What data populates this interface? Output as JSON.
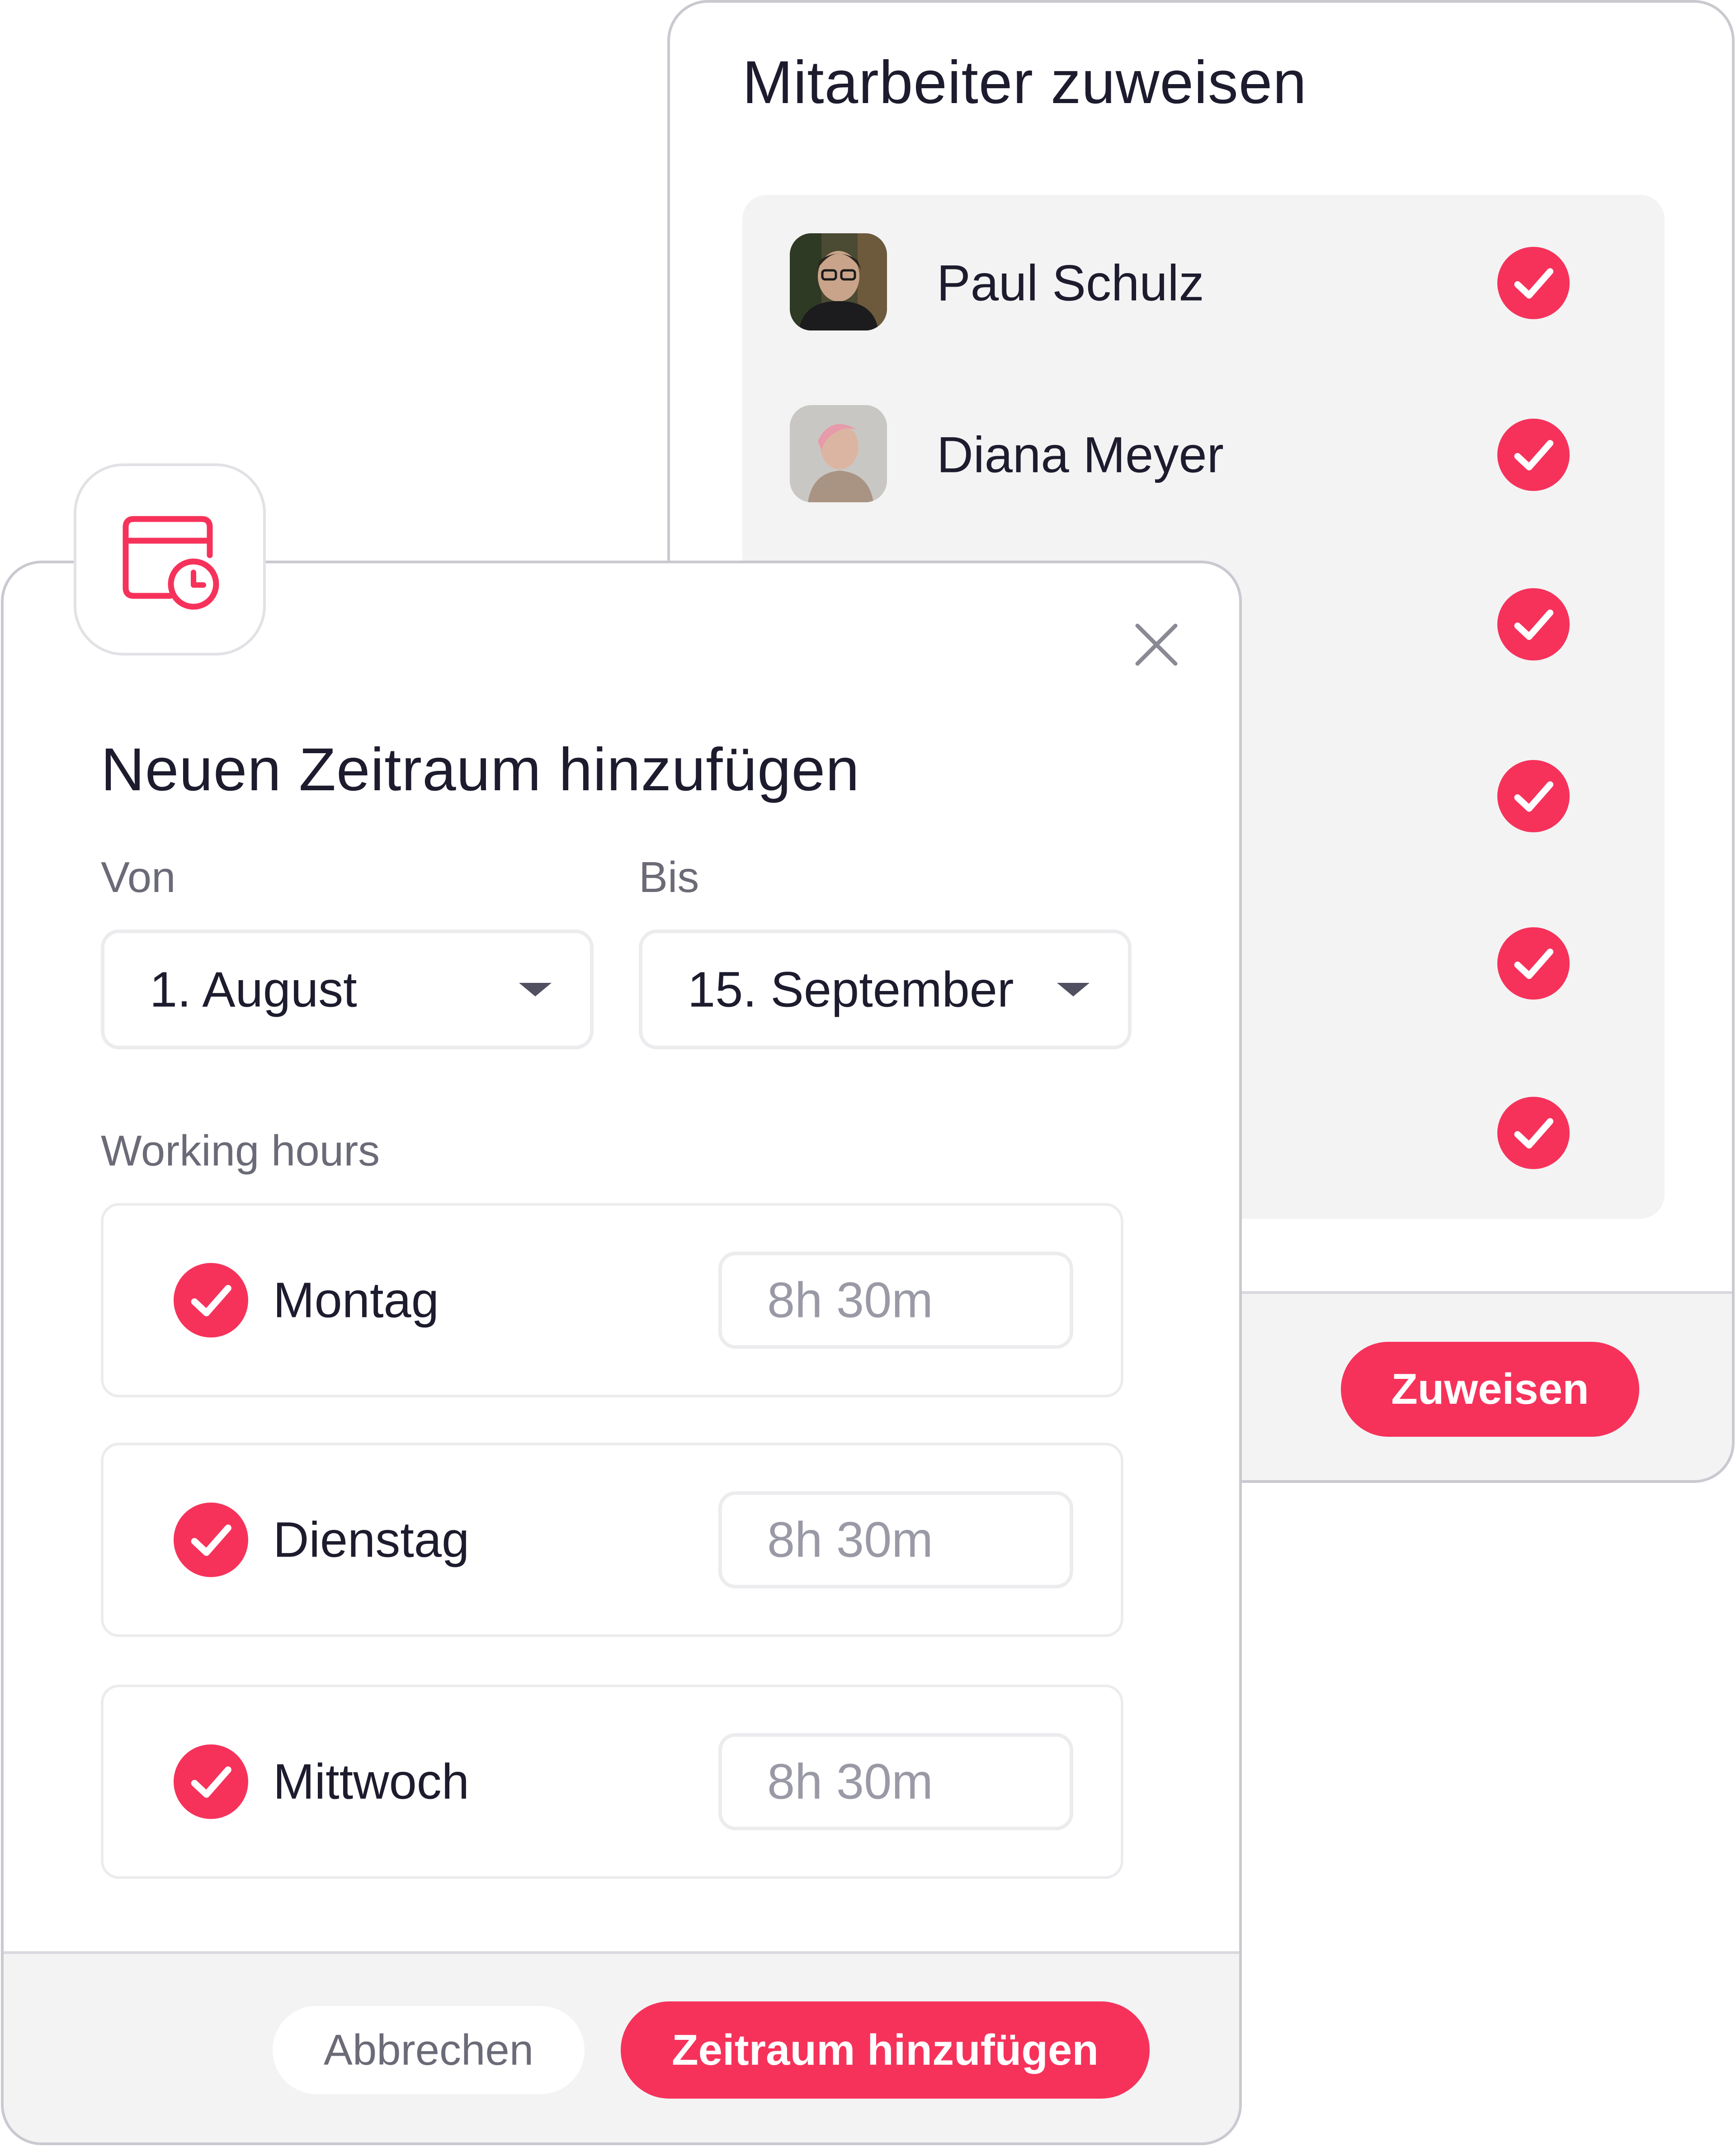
{
  "colors": {
    "accent": "#f6325b",
    "text_primary": "#1d1c2e",
    "text_muted": "#6b6b78",
    "panel_bg": "#f3f3f4"
  },
  "assign_panel": {
    "title": "Mitarbeiter zuweisen",
    "employees": [
      {
        "name": "Paul Schulz",
        "checked": true
      },
      {
        "name": "Diana Meyer",
        "checked": true
      },
      {
        "name": "",
        "checked": true
      },
      {
        "name": "",
        "checked": true
      },
      {
        "name": "",
        "checked": true
      },
      {
        "name": "",
        "checked": true
      }
    ],
    "assign_button_label": "Zuweisen"
  },
  "period_dialog": {
    "icon": "calendar-clock-icon",
    "title": "Neuen Zeitraum hinzufügen",
    "from_label": "Von",
    "from_value": "1. August",
    "to_label": "Bis",
    "to_value": "15. September",
    "working_hours_label": "Working hours",
    "days": [
      {
        "name": "Montag",
        "checked": true,
        "hours_placeholder": "8h 30m"
      },
      {
        "name": "Dienstag",
        "checked": true,
        "hours_placeholder": "8h 30m"
      },
      {
        "name": "Mittwoch",
        "checked": true,
        "hours_placeholder": "8h 30m"
      }
    ],
    "cancel_label": "Abbrechen",
    "submit_label": "Zeitraum hinzufügen"
  }
}
